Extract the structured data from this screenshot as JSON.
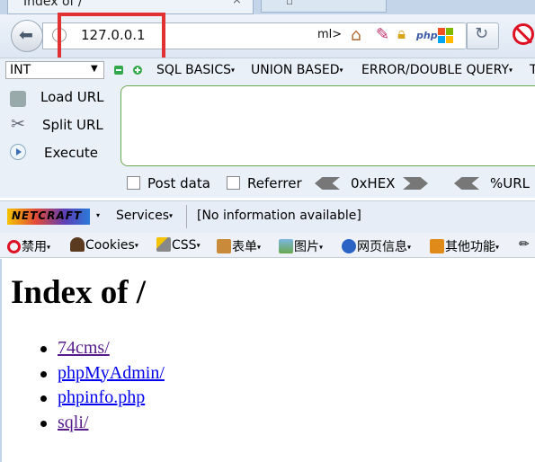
{
  "tab": {
    "title": "Index of /",
    "close_glyph": "×"
  },
  "toolbar": {
    "url": "127.0.0.1",
    "url_suffix": "ml>",
    "php_badge": "php",
    "colors": {
      "highlight": "#e03232"
    }
  },
  "hackbar": {
    "select_value": "INT",
    "menus": [
      {
        "label": "SQL BASICS"
      },
      {
        "label": "UNION BASED"
      },
      {
        "label": "ERROR/DOUBLE QUERY"
      },
      {
        "label": "T"
      }
    ],
    "buttons": {
      "load": "Load URL",
      "split": "Split URL",
      "execute": "Execute"
    },
    "options": {
      "post": "Post data",
      "referrer": "Referrer",
      "hex": "0xHEX",
      "url": "%URL"
    }
  },
  "netcraft": {
    "logo": "NETCRAFT",
    "services": "Services",
    "info": "[No information available]"
  },
  "webdev": [
    {
      "label": "禁用",
      "icon": "disable-icon"
    },
    {
      "label": "Cookies",
      "icon": "cookies-icon"
    },
    {
      "label": "CSS",
      "icon": "css-icon"
    },
    {
      "label": "表单",
      "icon": "forms-icon"
    },
    {
      "label": "图片",
      "icon": "images-icon"
    },
    {
      "label": "网页信息",
      "icon": "info-icon"
    },
    {
      "label": "其他功能",
      "icon": "misc-icon"
    }
  ],
  "page": {
    "title": "Index of /",
    "links": [
      {
        "label": "74cms/",
        "visited": true
      },
      {
        "label": "phpMyAdmin/",
        "visited": false
      },
      {
        "label": "phpinfo.php",
        "visited": false
      },
      {
        "label": "sqli/",
        "visited": true
      }
    ]
  }
}
